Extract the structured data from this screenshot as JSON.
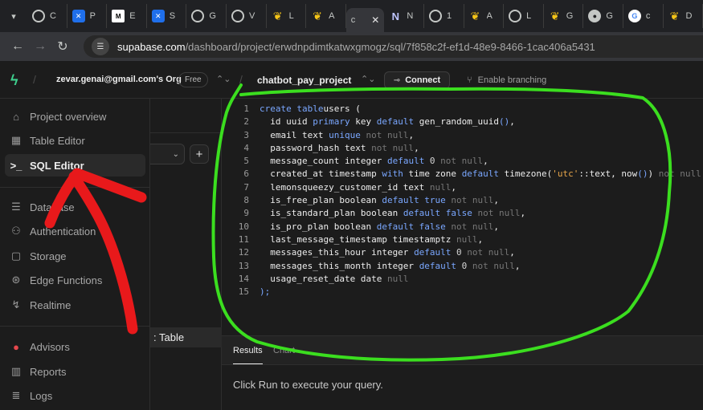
{
  "browser": {
    "tabs": [
      {
        "icon": "chatgpt-icon",
        "label": "C",
        "glyph": ""
      },
      {
        "icon": "confluence-icon",
        "label": "P",
        "glyph": "✕"
      },
      {
        "icon": "medium-icon",
        "label": "E",
        "glyph": "M"
      },
      {
        "icon": "confluence-icon",
        "label": "S",
        "glyph": "✕"
      },
      {
        "icon": "chatgpt-icon",
        "label": "G",
        "glyph": ""
      },
      {
        "icon": "chatgpt-icon",
        "label": "V",
        "glyph": ""
      },
      {
        "icon": "langchain-icon",
        "label": "L",
        "glyph": "❦"
      },
      {
        "icon": "langchain-icon",
        "label": "A",
        "glyph": "❦"
      },
      {
        "icon": "supabase-icon",
        "label": "c",
        "glyph": "c"
      },
      {
        "icon": "notion-icon",
        "label": "N",
        "glyph": "N"
      },
      {
        "icon": "globe-icon",
        "label": "1",
        "glyph": ""
      },
      {
        "icon": "langchain-icon",
        "label": "A",
        "glyph": "❦"
      },
      {
        "icon": "chatgpt-icon",
        "label": "L",
        "glyph": ""
      },
      {
        "icon": "langchain-icon",
        "label": "G",
        "glyph": "❦"
      },
      {
        "icon": "github-icon",
        "label": "G",
        "glyph": "●"
      },
      {
        "icon": "google-icon",
        "label": "c",
        "glyph": "G"
      },
      {
        "icon": "langchain-icon",
        "label": "D",
        "glyph": "❦"
      }
    ],
    "url_host": "supabase.com",
    "url_path": "/dashboard/project/erwdnpdimtkatwxgmogz/sql/7f858c2f-ef1d-48e9-8466-1cac406a5431"
  },
  "header": {
    "org": "zevar.genai@gmail.com's Org",
    "plan_badge": "Free",
    "project": "chatbot_pay_project",
    "connect_label": "Connect",
    "branching_label": "Enable branching"
  },
  "sidebar": {
    "items": [
      {
        "label": "Project overview",
        "icon": "home-icon",
        "active": false
      },
      {
        "label": "Table Editor",
        "icon": "table-icon",
        "active": false
      },
      {
        "label": "SQL Editor",
        "icon": "terminal-icon",
        "active": true
      },
      {
        "label": "Database",
        "icon": "database-icon",
        "active": false
      },
      {
        "label": "Authentication",
        "icon": "users-icon",
        "active": false
      },
      {
        "label": "Storage",
        "icon": "storage-icon",
        "active": false
      },
      {
        "label": "Edge Functions",
        "icon": "functions-icon",
        "active": false
      },
      {
        "label": "Realtime",
        "icon": "realtime-icon",
        "active": false
      },
      {
        "label": "Advisors",
        "icon": "lightbulb-icon",
        "active": false
      },
      {
        "label": "Reports",
        "icon": "chart-icon",
        "active": false
      },
      {
        "label": "Logs",
        "icon": "list-icon",
        "active": false
      }
    ]
  },
  "subpanel": {
    "add_label": "+",
    "selected_item": ": Table"
  },
  "editor": {
    "line_numbers": [
      "1",
      "2",
      "3",
      "4",
      "5",
      "6",
      "7",
      "8",
      "9",
      "10",
      "11",
      "12",
      "13",
      "14",
      "15"
    ]
  },
  "results": {
    "tab_results": "Results",
    "tab_chart": "Chart",
    "message": "Click Run to execute your query."
  },
  "colors": {
    "accent_green": "#3ecf8e",
    "annotation_green": "#3bde1f",
    "annotation_red": "#e8191b"
  }
}
